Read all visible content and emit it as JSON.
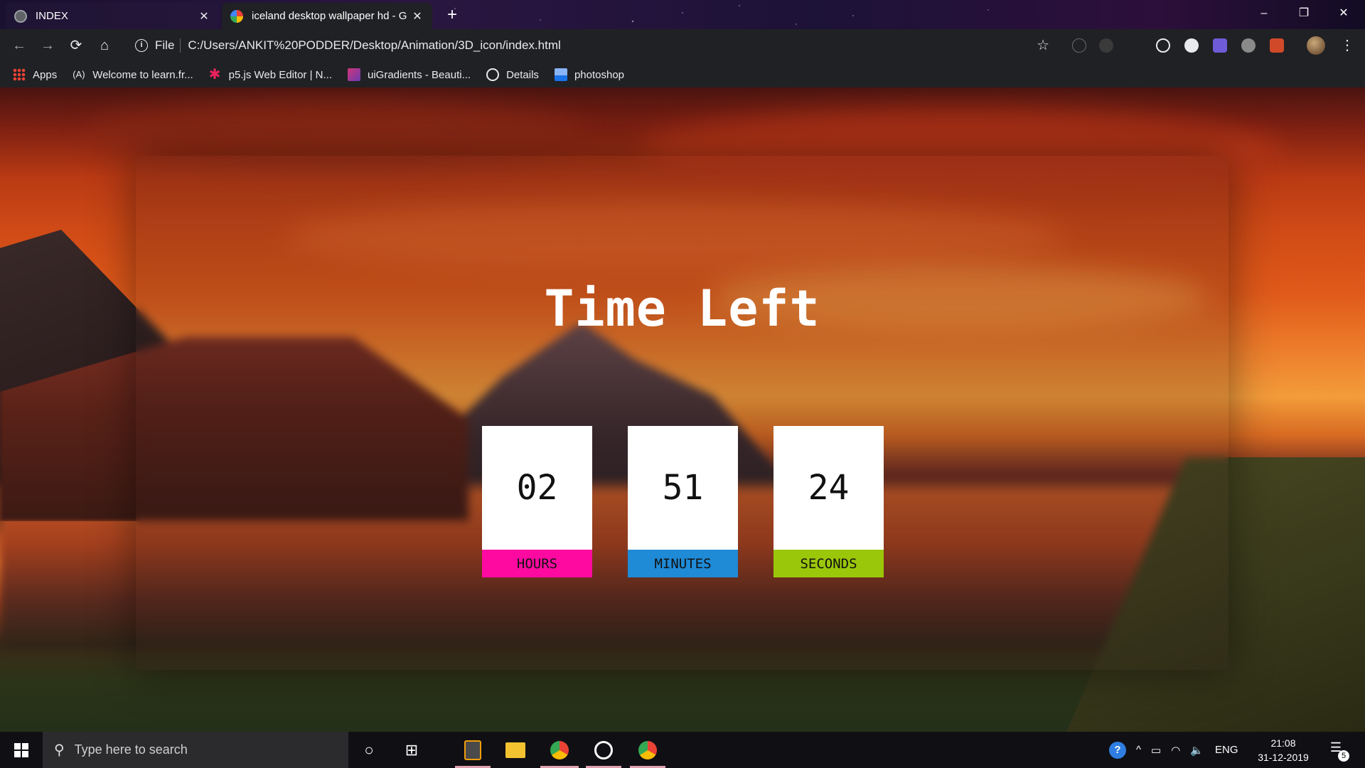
{
  "browser": {
    "tabs": [
      {
        "title": "INDEX",
        "active": false
      },
      {
        "title": "iceland desktop wallpaper hd - G",
        "active": true
      }
    ],
    "new_tab": "+",
    "window_controls": {
      "minimize": "–",
      "restore": "❐",
      "close": "✕"
    },
    "nav": {
      "back": "←",
      "forward": "→",
      "reload": "⟳",
      "home": "⌂"
    },
    "address": {
      "info": "i",
      "scheme_label": "File",
      "url": "C:/Users/ANKIT%20PODDER/Desktop/Animation/3D_icon/index.html"
    },
    "bookmarks": [
      {
        "label": "Apps",
        "icon": "apps-grid-icon"
      },
      {
        "label": "Welcome to learn.fr...",
        "icon": "freecodecamp-icon"
      },
      {
        "label": "p5.js Web Editor | N...",
        "icon": "p5js-icon"
      },
      {
        "label": "uiGradients - Beauti...",
        "icon": "uigradients-icon"
      },
      {
        "label": "Details",
        "icon": "globe-icon"
      },
      {
        "label": "photoshop",
        "icon": "image-icon"
      }
    ]
  },
  "page": {
    "headline": "Time Left",
    "timers": [
      {
        "value": "02",
        "unit": "HOURS",
        "color": "#ff0aa0"
      },
      {
        "value": "51",
        "unit": "MINUTES",
        "color": "#1f8ad6"
      },
      {
        "value": "24",
        "unit": "SECONDS",
        "color": "#9ac70a"
      }
    ]
  },
  "taskbar": {
    "search_placeholder": "Type here to search",
    "language": "ENG",
    "time": "21:08",
    "date": "31-12-2019",
    "notification_count": "5"
  }
}
